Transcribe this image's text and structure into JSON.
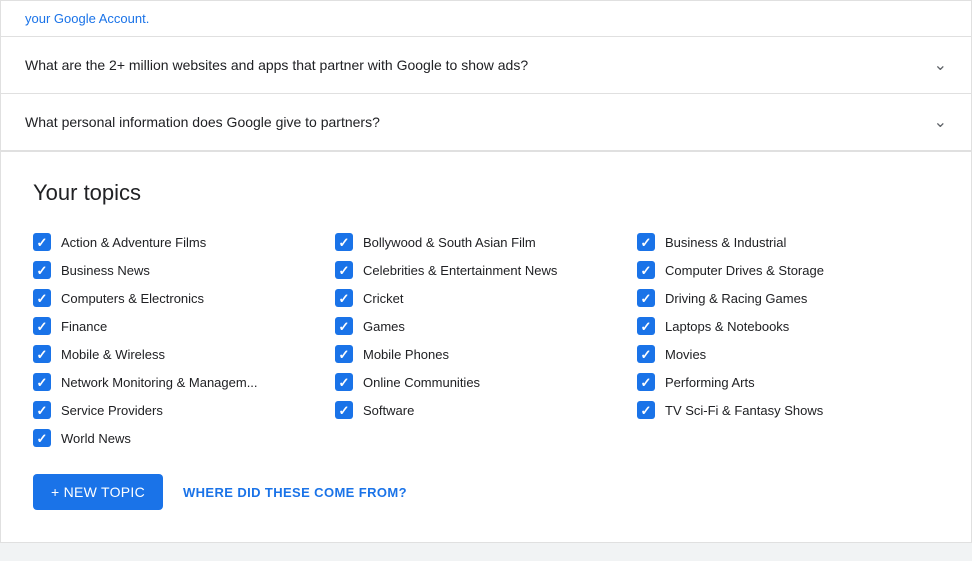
{
  "faq": {
    "items": [
      {
        "id": "faq-1",
        "question": "What are the 2+ million websites and apps that partner with Google to show ads?"
      },
      {
        "id": "faq-2",
        "question": "What personal information does Google give to partners?"
      }
    ]
  },
  "topics": {
    "title": "Your topics",
    "columns": [
      [
        {
          "id": "t1",
          "label": "Action & Adventure Films",
          "checked": true
        },
        {
          "id": "t2",
          "label": "Business News",
          "checked": true
        },
        {
          "id": "t3",
          "label": "Computers & Electronics",
          "checked": true
        },
        {
          "id": "t4",
          "label": "Finance",
          "checked": true
        },
        {
          "id": "t5",
          "label": "Mobile & Wireless",
          "checked": true
        },
        {
          "id": "t6",
          "label": "Network Monitoring & Managem...",
          "checked": true
        },
        {
          "id": "t7",
          "label": "Service Providers",
          "checked": true
        },
        {
          "id": "t8",
          "label": "World News",
          "checked": true
        }
      ],
      [
        {
          "id": "t9",
          "label": "Bollywood & South Asian Film",
          "checked": true
        },
        {
          "id": "t10",
          "label": "Celebrities & Entertainment News",
          "checked": true
        },
        {
          "id": "t11",
          "label": "Cricket",
          "checked": true
        },
        {
          "id": "t12",
          "label": "Games",
          "checked": true
        },
        {
          "id": "t13",
          "label": "Mobile Phones",
          "checked": true
        },
        {
          "id": "t14",
          "label": "Online Communities",
          "checked": true
        },
        {
          "id": "t15",
          "label": "Software",
          "checked": true
        }
      ],
      [
        {
          "id": "t16",
          "label": "Business & Industrial",
          "checked": true
        },
        {
          "id": "t17",
          "label": "Computer Drives & Storage",
          "checked": true
        },
        {
          "id": "t18",
          "label": "Driving & Racing Games",
          "checked": true
        },
        {
          "id": "t19",
          "label": "Laptops & Notebooks",
          "checked": true
        },
        {
          "id": "t20",
          "label": "Movies",
          "checked": true
        },
        {
          "id": "t21",
          "label": "Performing Arts",
          "checked": true
        },
        {
          "id": "t22",
          "label": "TV Sci-Fi & Fantasy Shows",
          "checked": true
        }
      ]
    ],
    "actions": {
      "new_topic_label": "+ NEW TOPIC",
      "where_label": "WHERE DID THESE COME FROM?"
    }
  }
}
